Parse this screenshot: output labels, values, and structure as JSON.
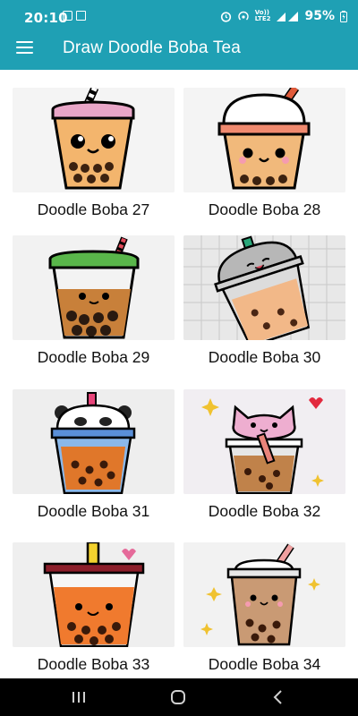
{
  "status": {
    "time": "20:10",
    "network": "VoLTE 4G+",
    "net_line1": "Vo))",
    "net_line2": "LTE2",
    "battery": "95%"
  },
  "app": {
    "title": "Draw Doodle Boba Tea"
  },
  "items": [
    {
      "label": "Doodle Boba 27"
    },
    {
      "label": "Doodle Boba 28"
    },
    {
      "label": "Doodle Boba 29"
    },
    {
      "label": "Doodle Boba 30"
    },
    {
      "label": "Doodle Boba 31"
    },
    {
      "label": "Doodle Boba 32"
    },
    {
      "label": "Doodle Boba 33"
    },
    {
      "label": "Doodle Boba 34"
    }
  ],
  "colors": {
    "app_bar": "#1fa0b4",
    "nav_bar": "#000000"
  },
  "nav": {
    "icons": [
      "recents-icon",
      "home-icon",
      "back-icon"
    ]
  }
}
